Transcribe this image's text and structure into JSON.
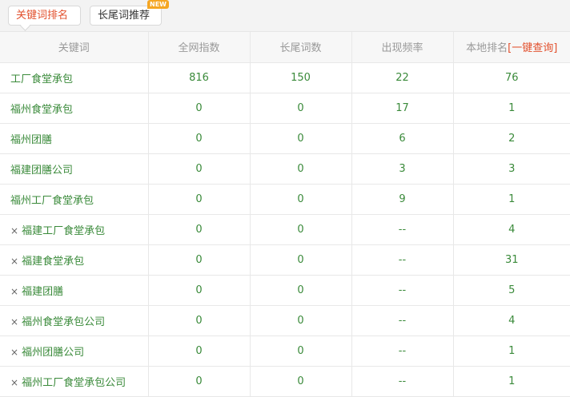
{
  "tabs": [
    {
      "label": "关键词排名",
      "active": true
    },
    {
      "label": "长尾词推荐",
      "active": false,
      "badge": "NEW"
    }
  ],
  "table": {
    "headers": {
      "keyword": "关键词",
      "index": "全网指数",
      "longtail": "长尾词数",
      "frequency": "出现频率",
      "rank": "本地排名",
      "rank_link": "[一键查询]"
    },
    "rows": [
      {
        "removable": false,
        "keyword": "工厂食堂承包",
        "index": "816",
        "longtail": "150",
        "frequency": "22",
        "rank": "76"
      },
      {
        "removable": false,
        "keyword": "福州食堂承包",
        "index": "0",
        "longtail": "0",
        "frequency": "17",
        "rank": "1"
      },
      {
        "removable": false,
        "keyword": "福州团膳",
        "index": "0",
        "longtail": "0",
        "frequency": "6",
        "rank": "2"
      },
      {
        "removable": false,
        "keyword": "福建团膳公司",
        "index": "0",
        "longtail": "0",
        "frequency": "3",
        "rank": "3"
      },
      {
        "removable": false,
        "keyword": "福州工厂食堂承包",
        "index": "0",
        "longtail": "0",
        "frequency": "9",
        "rank": "1"
      },
      {
        "removable": true,
        "keyword": "福建工厂食堂承包",
        "index": "0",
        "longtail": "0",
        "frequency": "--",
        "rank": "4"
      },
      {
        "removable": true,
        "keyword": "福建食堂承包",
        "index": "0",
        "longtail": "0",
        "frequency": "--",
        "rank": "31"
      },
      {
        "removable": true,
        "keyword": "福建团膳",
        "index": "0",
        "longtail": "0",
        "frequency": "--",
        "rank": "5"
      },
      {
        "removable": true,
        "keyword": "福州食堂承包公司",
        "index": "0",
        "longtail": "0",
        "frequency": "--",
        "rank": "4"
      },
      {
        "removable": true,
        "keyword": "福州团膳公司",
        "index": "0",
        "longtail": "0",
        "frequency": "--",
        "rank": "1"
      },
      {
        "removable": true,
        "keyword": "福州工厂食堂承包公司",
        "index": "0",
        "longtail": "0",
        "frequency": "--",
        "rank": "1"
      }
    ],
    "remove_symbol": "×"
  },
  "colors": {
    "accent": "#e2502d",
    "value_green": "#3a8a3a",
    "badge": "#f5a623"
  }
}
